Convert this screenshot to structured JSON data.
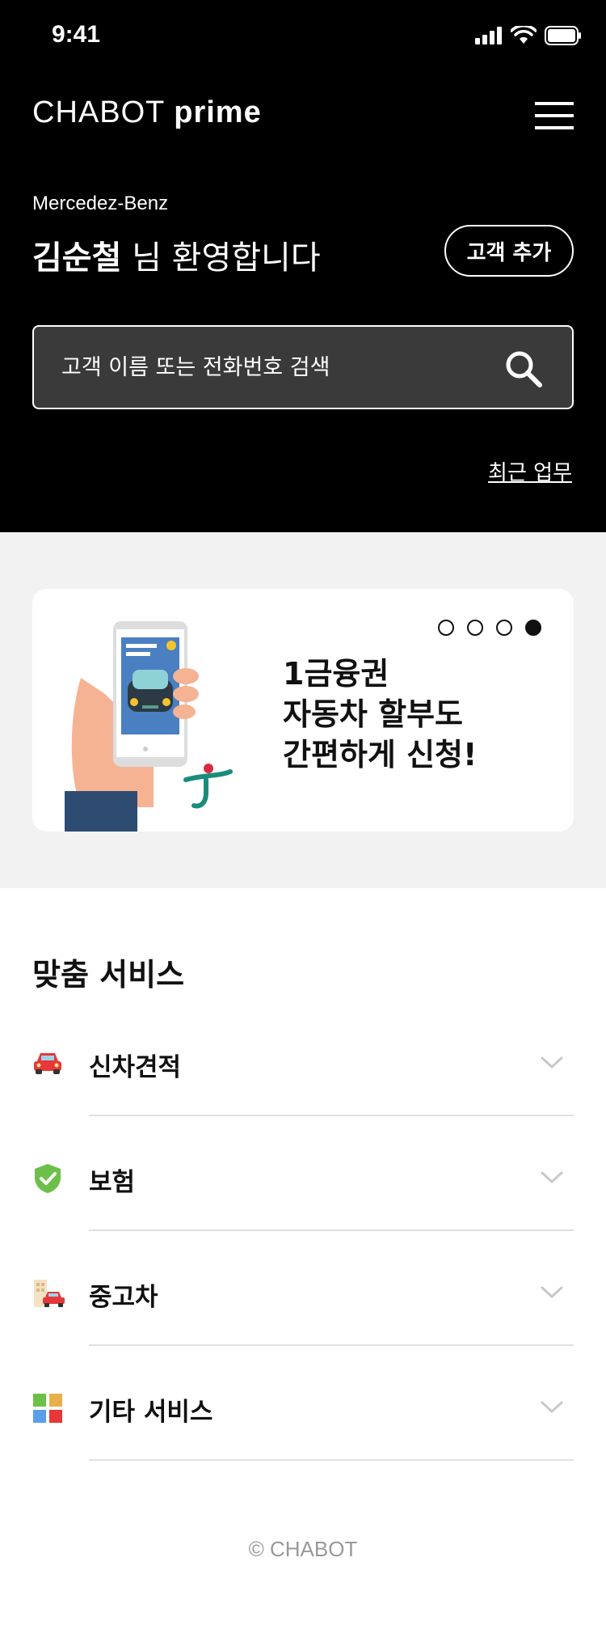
{
  "status_bar": {
    "time": "9:41"
  },
  "header": {
    "brand_regular": "CHABOT",
    "brand_bold": "prime",
    "dealer": "Mercedez-Benz",
    "user_name": "김순철",
    "welcome_suffix": "님 환영합니다",
    "add_customer_label": "고객 추가"
  },
  "search": {
    "placeholder": "고객 이름 또는 전화번호 검색",
    "value": ""
  },
  "recent_tasks_label": "최근 업무",
  "banner": {
    "lines": [
      "1금융권",
      "자동차 할부도",
      "간편하게 신청!"
    ],
    "page_count": 4,
    "active_page": 4
  },
  "services": {
    "title": "맞춤 서비스",
    "items": [
      {
        "label": "신차견적",
        "icon": "car-icon"
      },
      {
        "label": "보험",
        "icon": "shield-check-icon"
      },
      {
        "label": "중고차",
        "icon": "used-car-icon"
      },
      {
        "label": "기타 서비스",
        "icon": "grid-icon"
      }
    ]
  },
  "footer": {
    "copyright": "© CHABOT"
  },
  "colors": {
    "accent_black": "#000000",
    "shield_green": "#6cc04a",
    "car_red": "#e63838",
    "banner_bg": "#f2f2f2"
  }
}
